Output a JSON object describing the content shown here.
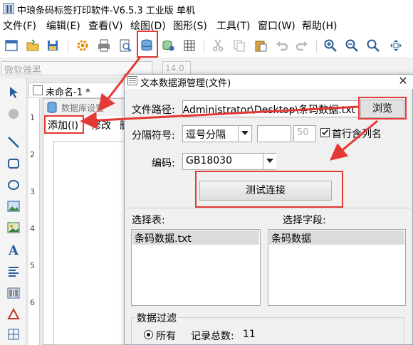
{
  "window": {
    "title": "中琅条码标签打印软件-V6.5.3 工业版 单机"
  },
  "menubar": {
    "items": [
      "文件(F)",
      "编辑(E)",
      "查看(V)",
      "绘图(D)",
      "图形(S)",
      "工具(T)",
      "窗口(W)",
      "帮助(H)"
    ]
  },
  "fontbar": {
    "font_name": "微软雅黑",
    "font_size": "14.0"
  },
  "document": {
    "tab_label": "未命名-1 *"
  },
  "ruler": {
    "marks": [
      "1",
      "2",
      "3",
      "4",
      "5",
      "6"
    ]
  },
  "db_window": {
    "title": "数据库设置",
    "menu": {
      "add": "添加(I)",
      "edit": "修改",
      "more": "删"
    }
  },
  "dialog": {
    "title": "文本数据源管理(文件)",
    "close_glyph": "✕",
    "file_path_label": "文件路径:",
    "file_path_value": "ers\\Administrator\\Desktop\\条码数据.txt",
    "browse_label": "浏览",
    "separator_label": "分隔符号:",
    "separator_value": "逗号分隔",
    "separator_num": "50",
    "first_row_checked": true,
    "first_row_label": "首行含列名",
    "encoding_label": "编码:",
    "encoding_value": "GB18030",
    "test_button": "测试连接",
    "select_table_label": "选择表:",
    "select_field_label": "选择字段:",
    "tables": [
      "条码数据.txt"
    ],
    "fields": [
      "条码数据"
    ],
    "filter_label": "数据过滤",
    "filter_all": "所有",
    "record_count_label": "记录总数:",
    "record_count": "11"
  },
  "colors": {
    "highlight": "#e53935",
    "accent": "#1e6fd9"
  }
}
